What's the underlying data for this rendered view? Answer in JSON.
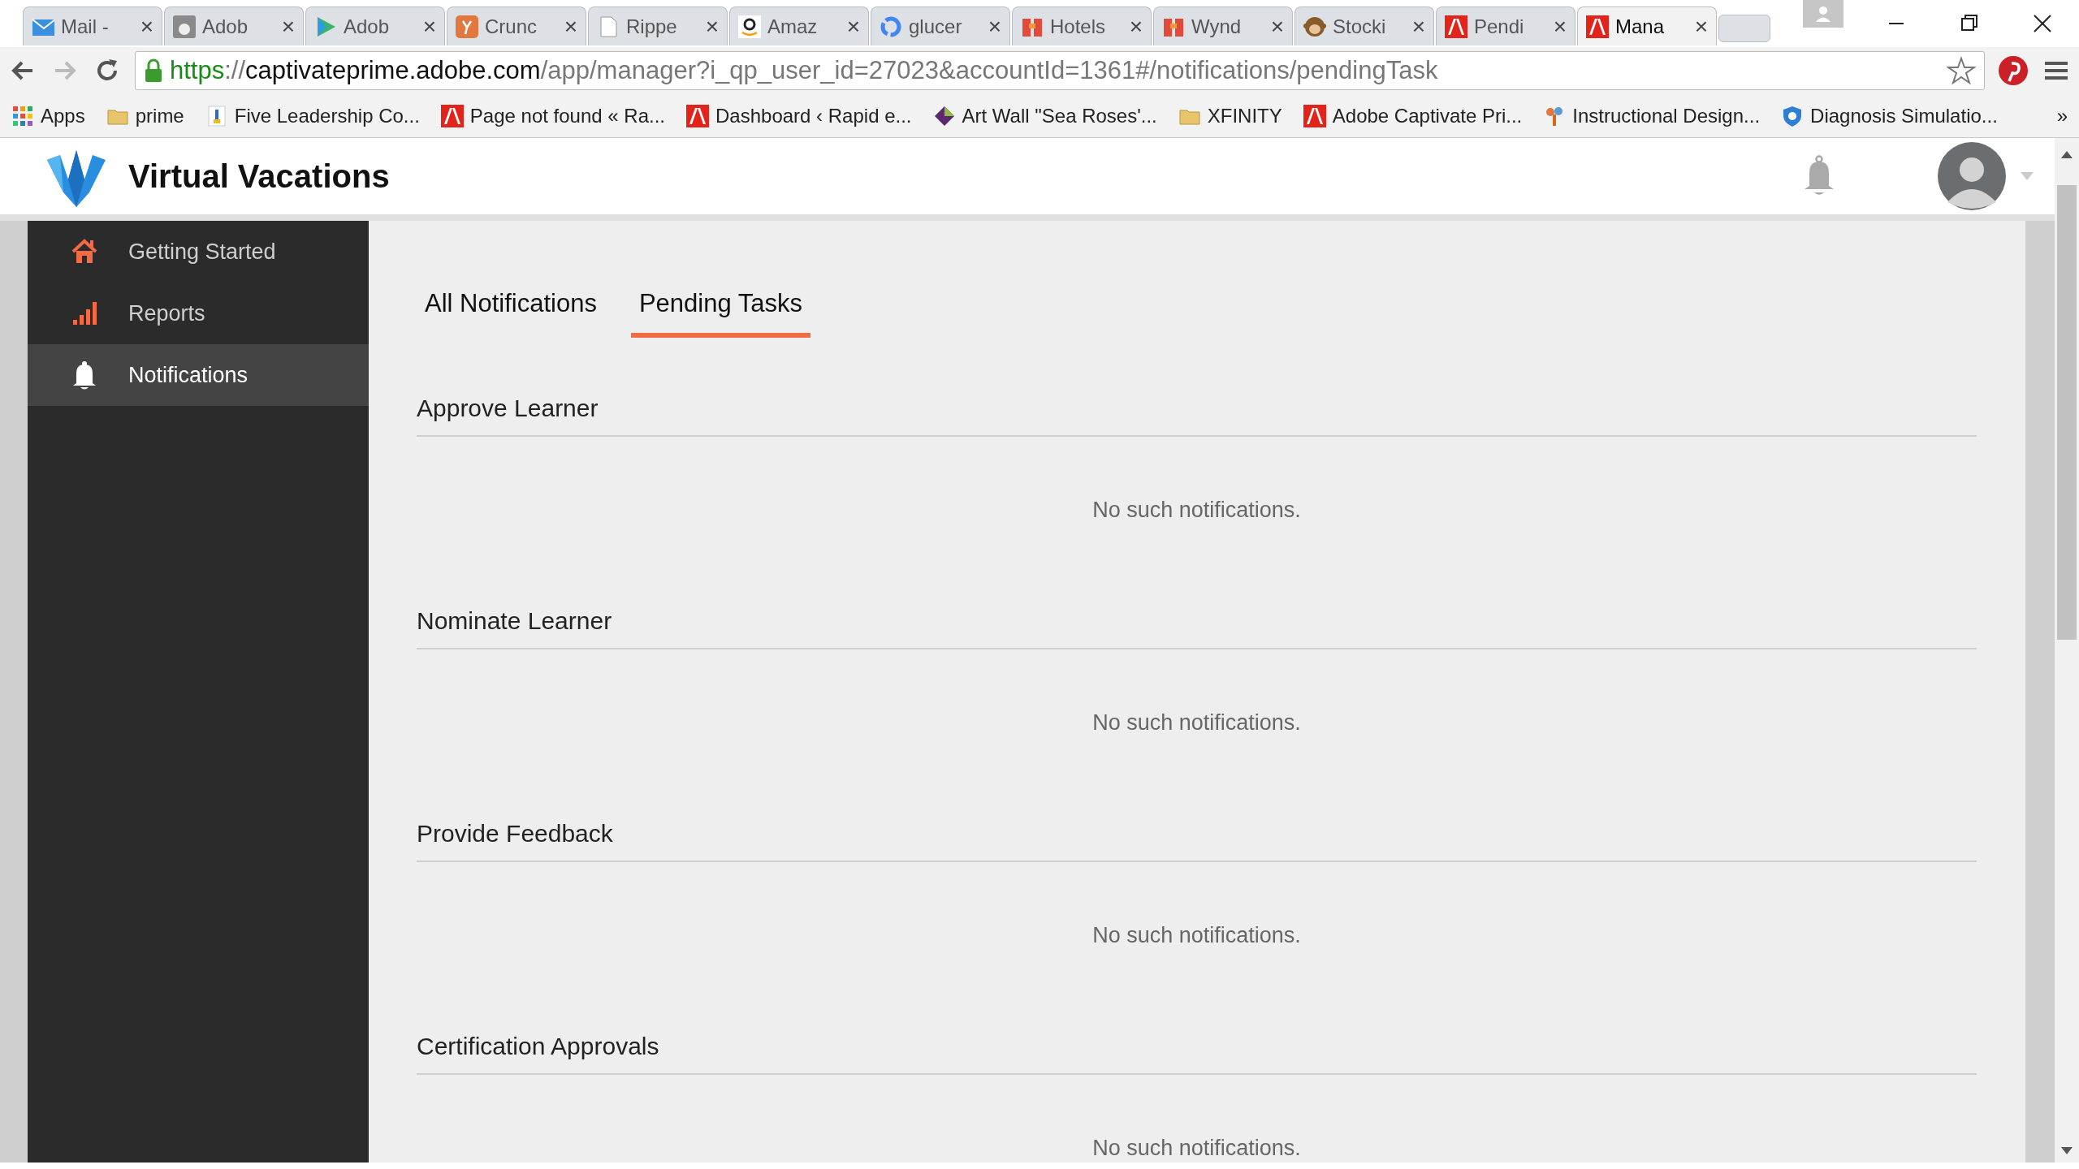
{
  "browser": {
    "tabs": [
      {
        "title": "Mail -",
        "selected": false
      },
      {
        "title": "Adob",
        "selected": false
      },
      {
        "title": "Adob",
        "selected": false
      },
      {
        "title": "Crunc",
        "selected": false
      },
      {
        "title": "Rippe",
        "selected": false
      },
      {
        "title": "Amaz",
        "selected": false
      },
      {
        "title": "glucer",
        "selected": false
      },
      {
        "title": "Hotels",
        "selected": false
      },
      {
        "title": "Wynd",
        "selected": false
      },
      {
        "title": "Stocki",
        "selected": false
      },
      {
        "title": "Pendi",
        "selected": false
      },
      {
        "title": "Mana",
        "selected": true
      }
    ],
    "tab_close": "×",
    "url": "https://captivateprime.adobe.com/app/manager?i_qp_user_id=27023&accountId=1361#/notifications/pendingTask",
    "bookmarks": [
      "Apps",
      "prime",
      "Five Leadership Co...",
      "Page not found « Ra...",
      "Dashboard ‹ Rapid e...",
      "Art Wall \"Sea Roses'...",
      "XFINITY",
      "Adobe Captivate Pri...",
      "Instructional Design...",
      "Diagnosis Simulatio..."
    ],
    "bookmarks_overflow": "»"
  },
  "app": {
    "title": "Virtual Vacations"
  },
  "sidebar": {
    "items": [
      {
        "label": "Getting Started",
        "selected": false
      },
      {
        "label": "Reports",
        "selected": false
      },
      {
        "label": "Notifications",
        "selected": true
      }
    ]
  },
  "tabs": [
    {
      "label": "All Notifications",
      "selected": false
    },
    {
      "label": "Pending Tasks",
      "selected": true
    }
  ],
  "sections": [
    {
      "title": "Approve Learner",
      "message": "No such notifications."
    },
    {
      "title": "Nominate Learner",
      "message": "No such notifications."
    },
    {
      "title": "Provide Feedback",
      "message": "No such notifications."
    },
    {
      "title": "Certification Approvals",
      "message": "No such notifications."
    }
  ]
}
